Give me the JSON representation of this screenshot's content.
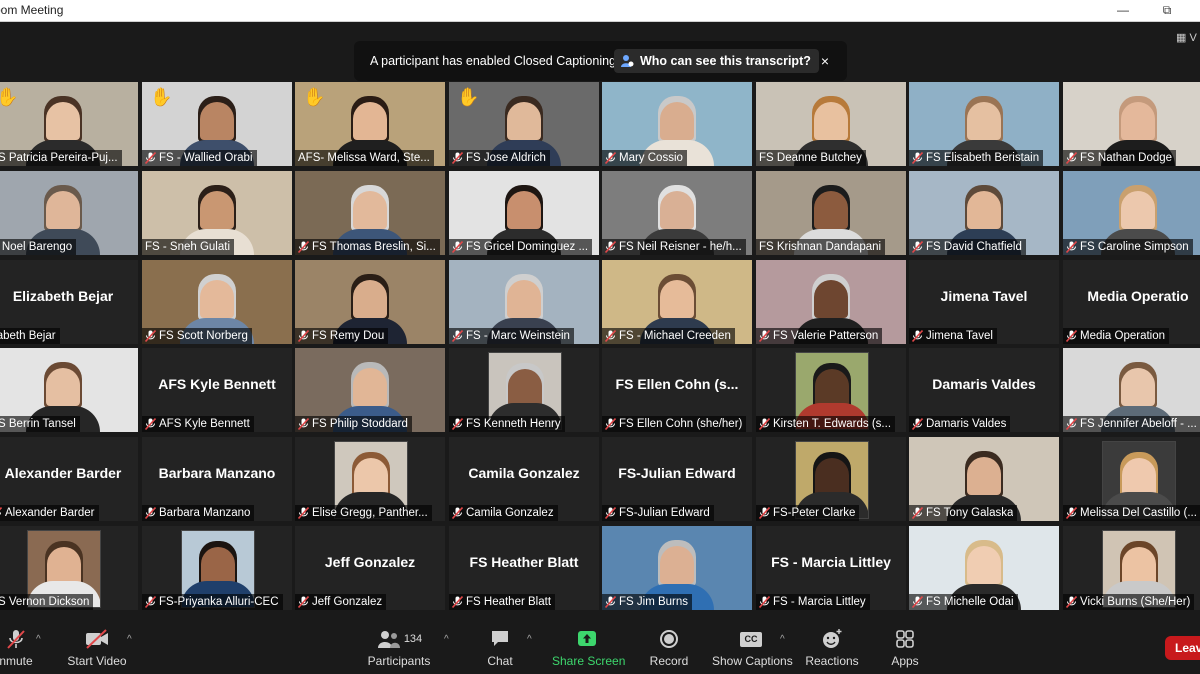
{
  "window": {
    "title": "oom Meeting",
    "minimize": "—",
    "restore": "⧉"
  },
  "banner": {
    "message": "A participant has enabled Closed Captioning",
    "who_label": "Who can see this transcript?",
    "close": "×"
  },
  "view_label": "V",
  "tiles": [
    {
      "label": "FS Patricia Pereira-Puj...",
      "muted": false,
      "hand": true,
      "kind": "video",
      "bg": "#b8b0a0",
      "skin": "#e7c2a4",
      "shirt": "#2b2b2b",
      "hair": "#4a3325"
    },
    {
      "label": "FS - Wallied Orabi",
      "muted": true,
      "hand": true,
      "kind": "video",
      "bg": "#d3d3d3",
      "skin": "#b98563",
      "shirt": "#3e4f6b",
      "hair": "#2b1f18"
    },
    {
      "label": "AFS- Melissa Ward, Ste...",
      "muted": false,
      "hand": true,
      "active": true,
      "kind": "video",
      "bg": "#b9a27a",
      "skin": "#e3b694",
      "shirt": "#1f1f1f",
      "hair": "#2a1c14"
    },
    {
      "label": "FS Jose Aldrich",
      "muted": true,
      "hand": true,
      "kind": "video",
      "bg": "#6a6a6a",
      "skin": "#e0b99a",
      "shirt": "#2f3d57",
      "hair": "#3a2a20"
    },
    {
      "label": "Mary Cossio",
      "muted": true,
      "hand": false,
      "kind": "video",
      "bg": "#8fb5c9",
      "skin": "#d9ad8f",
      "shirt": "#e9e2d8",
      "hair": "#c9c9c9"
    },
    {
      "label": "FS Deanne Butchey",
      "muted": false,
      "hand": false,
      "kind": "video",
      "bg": "#c9c2b6",
      "skin": "#e8c19f",
      "shirt": "#2f2f2f",
      "hair": "#b77a3a"
    },
    {
      "label": "FS Elisabeth Beristain",
      "muted": true,
      "hand": false,
      "kind": "video",
      "bg": "#8fb0c6",
      "skin": "#e5c0a1",
      "shirt": "#3a3a3a",
      "hair": "#9a7454"
    },
    {
      "label": "FS Nathan Dodge",
      "muted": true,
      "hand": false,
      "kind": "video",
      "bg": "#d7d2c9",
      "skin": "#e4b89b",
      "shirt": "#1d1d1d",
      "hair": "#c49a7c"
    },
    {
      "label": "S Noel Barengo",
      "muted": false,
      "hand": false,
      "kind": "video",
      "bg": "#9fa6ae",
      "skin": "#dfb699",
      "shirt": "#3f4a58",
      "hair": "#6a5a4c"
    },
    {
      "label": "FS - Sneh Gulati",
      "muted": false,
      "hand": false,
      "kind": "video",
      "bg": "#cdbfa9",
      "skin": "#c99772",
      "shirt": "#e8dfd3",
      "hair": "#2b1f18"
    },
    {
      "label": "FS Thomas Breslin, Si...",
      "muted": true,
      "hand": false,
      "kind": "video",
      "bg": "#7b6a55",
      "skin": "#e2b99b",
      "shirt": "#3d5679",
      "hair": "#d8d8d8"
    },
    {
      "label": "FS Gricel Dominguez ...",
      "muted": true,
      "hand": false,
      "kind": "video",
      "bg": "#e3e3e3",
      "skin": "#c88f6e",
      "shirt": "#2c2c2c",
      "hair": "#1e1612"
    },
    {
      "label": "FS Neil Reisner - he/h...",
      "muted": true,
      "hand": false,
      "kind": "video",
      "bg": "#7d7d7d",
      "skin": "#d9b095",
      "shirt": "#3b3b3b",
      "hair": "#e0e0e0"
    },
    {
      "label": "FS Krishnan Dandapani",
      "muted": false,
      "hand": false,
      "kind": "video",
      "bg": "#a59a8a",
      "skin": "#8c5b3e",
      "shirt": "#dcdcdc",
      "hair": "#1c1c1c"
    },
    {
      "label": "FS David Chatfield",
      "muted": true,
      "hand": false,
      "kind": "video",
      "bg": "#a6b7c6",
      "skin": "#e2b797",
      "shirt": "#2d3e55",
      "hair": "#5e4a3a"
    },
    {
      "label": "FS Caroline Simpson",
      "muted": true,
      "hand": false,
      "kind": "video",
      "bg": "#7f9fba",
      "skin": "#ecc8ad",
      "shirt": "#4b4b4b",
      "hair": "#c9a06e"
    },
    {
      "label": "zabeth Bejar",
      "big": "Elizabeth Bejar",
      "muted": false,
      "hand": false,
      "kind": "name"
    },
    {
      "label": "FS Scott Norberg",
      "muted": true,
      "hand": false,
      "kind": "video",
      "bg": "#8a6f4e",
      "skin": "#e4b99a",
      "shirt": "#6d86a6",
      "hair": "#d0d0d0"
    },
    {
      "label": "FS Remy Dou",
      "muted": true,
      "hand": false,
      "kind": "video",
      "bg": "#9b8467",
      "skin": "#d9ad8c",
      "shirt": "#1e2433",
      "hair": "#2a1e16"
    },
    {
      "label": "FS - Marc Weinstein",
      "muted": true,
      "hand": false,
      "kind": "video",
      "bg": "#a4b3c0",
      "skin": "#e0b495",
      "shirt": "#3a4150",
      "hair": "#cfcfcf"
    },
    {
      "label": "FS - Michael Creeden",
      "muted": true,
      "hand": false,
      "kind": "video",
      "bg": "#cfb887",
      "skin": "#e6bb99",
      "shirt": "#2e3b4e",
      "hair": "#6b4d35"
    },
    {
      "label": "FS Valerie Patterson",
      "muted": true,
      "hand": false,
      "kind": "video",
      "bg": "#b59a9d",
      "skin": "#6e4630",
      "shirt": "#202020",
      "hair": "#cfcfcf"
    },
    {
      "label": "Jimena Tavel",
      "big": "Jimena Tavel",
      "muted": true,
      "hand": false,
      "kind": "name"
    },
    {
      "label": "Media Operation",
      "big": "Media Operatio",
      "muted": true,
      "hand": false,
      "kind": "name"
    },
    {
      "label": "FS Berrin Tansel",
      "muted": false,
      "hand": false,
      "kind": "video",
      "bg": "#e4e4e4",
      "skin": "#e5bfa2",
      "shirt": "#262626",
      "hair": "#6b4a34"
    },
    {
      "label": "AFS Kyle Bennett",
      "big": "AFS Kyle Bennett",
      "muted": true,
      "hand": false,
      "kind": "name"
    },
    {
      "label": "FS Philip Stoddard",
      "muted": true,
      "hand": false,
      "kind": "video",
      "bg": "#7a6b5e",
      "skin": "#e1b696",
      "shirt": "#3b5c8a",
      "hair": "#b9b9b9"
    },
    {
      "label": "FS Kenneth Henry",
      "muted": true,
      "hand": false,
      "kind": "photo",
      "bg": "#c9c4bd",
      "skin": "#8a5d43",
      "shirt": "#2d2d2d",
      "hair": "#c8c8c8"
    },
    {
      "label": "FS Ellen Cohn (she/her)",
      "big": "FS Ellen Cohn (s...",
      "muted": true,
      "hand": false,
      "kind": "name"
    },
    {
      "label": "Kirsten T. Edwards (s...",
      "muted": true,
      "hand": false,
      "kind": "photo",
      "bg": "#9aa86d",
      "skin": "#5b3a26",
      "shirt": "#b03a2e",
      "hair": "#1a1a1a"
    },
    {
      "label": "Damaris Valdes",
      "big": "Damaris Valdes",
      "muted": true,
      "hand": false,
      "kind": "name"
    },
    {
      "label": "FS Jennifer Abeloff - ...",
      "muted": true,
      "hand": false,
      "kind": "video",
      "bg": "#d9d9d9",
      "skin": "#e8c6ac",
      "shirt": "#5d6b78",
      "hair": "#7a5a40"
    },
    {
      "label": "Alexander Barder",
      "big": "Alexander Barder",
      "muted": true,
      "hand": false,
      "kind": "name"
    },
    {
      "label": "Barbara Manzano",
      "big": "Barbara Manzano",
      "muted": true,
      "hand": false,
      "kind": "name"
    },
    {
      "label": "Elise Gregg, Panther...",
      "muted": true,
      "hand": false,
      "kind": "photo",
      "bg": "#cfc8bd",
      "skin": "#ecc7aa",
      "shirt": "#262626",
      "hair": "#8c5a36"
    },
    {
      "label": "Camila Gonzalez",
      "big": "Camila Gonzalez",
      "muted": true,
      "hand": false,
      "kind": "name"
    },
    {
      "label": "FS-Julian Edward",
      "big": "FS-Julian Edward",
      "muted": true,
      "hand": false,
      "kind": "name"
    },
    {
      "label": "FS-Peter Clarke",
      "muted": true,
      "hand": false,
      "kind": "photo",
      "bg": "#bfa96a",
      "skin": "#4a2e20",
      "shirt": "#2b2b2b",
      "hair": "#151515"
    },
    {
      "label": "FS Tony Galaska",
      "muted": true,
      "hand": false,
      "kind": "video",
      "bg": "#cfc6b8",
      "skin": "#dcb091",
      "shirt": "#2a2a2a",
      "hair": "#3b2b20"
    },
    {
      "label": "Melissa Del Castillo (...",
      "muted": true,
      "hand": false,
      "kind": "photo",
      "bg": "#3b3b3b",
      "skin": "#efc9ae",
      "shirt": "#4b4b4b",
      "hair": "#c89a5a"
    },
    {
      "label": "FS Vernon Dickson",
      "muted": false,
      "hand": false,
      "kind": "photo",
      "bg": "#8a6a52",
      "skin": "#e0b292",
      "shirt": "#e8e8e8",
      "hair": "#4a3322"
    },
    {
      "label": "FS-Priyanka Alluri-CEC",
      "muted": true,
      "hand": false,
      "kind": "photo",
      "bg": "#b8c9d6",
      "skin": "#9a6547",
      "shirt": "#1f3f6b",
      "hair": "#1b1410"
    },
    {
      "label": "Jeff Gonzalez",
      "big": "Jeff Gonzalez",
      "muted": true,
      "hand": false,
      "kind": "name"
    },
    {
      "label": "FS Heather Blatt",
      "big": "FS Heather Blatt",
      "muted": true,
      "hand": false,
      "kind": "name"
    },
    {
      "label": "FS Jim Burns",
      "muted": true,
      "hand": false,
      "kind": "video",
      "bg": "#5a86b0",
      "skin": "#dcb093",
      "shirt": "#2f6fb3",
      "hair": "#bdbdbd"
    },
    {
      "label": "FS - Marcia Littley",
      "big": "FS - Marcia Littley",
      "muted": true,
      "hand": false,
      "kind": "name"
    },
    {
      "label": "FS Michelle Odai",
      "muted": true,
      "hand": false,
      "kind": "video",
      "bg": "#dfe6ea",
      "skin": "#f0cdb2",
      "shirt": "#2a2a2a",
      "hair": "#d8bb8a"
    },
    {
      "label": "Vicki Burns (She/Her)",
      "muted": true,
      "hand": false,
      "kind": "photo",
      "bg": "#d0c4b4",
      "skin": "#ecc3a3",
      "shirt": "#c9c9c9",
      "hair": "#6b4528"
    }
  ],
  "toolbar": {
    "unmute": "nmute",
    "start_video": "Start Video",
    "participants": "Participants",
    "participants_count": "134",
    "chat": "Chat",
    "share_screen": "Share Screen",
    "record": "Record",
    "show_captions": "Show Captions",
    "cc_badge": "CC",
    "reactions": "Reactions",
    "apps": "Apps",
    "leave": "Leav",
    "caret": "^"
  },
  "colors": {
    "share_green": "#3dd66d",
    "active_border": "#a6e05a",
    "leave_red": "#c8191c",
    "muted_red": "#e0484a"
  }
}
